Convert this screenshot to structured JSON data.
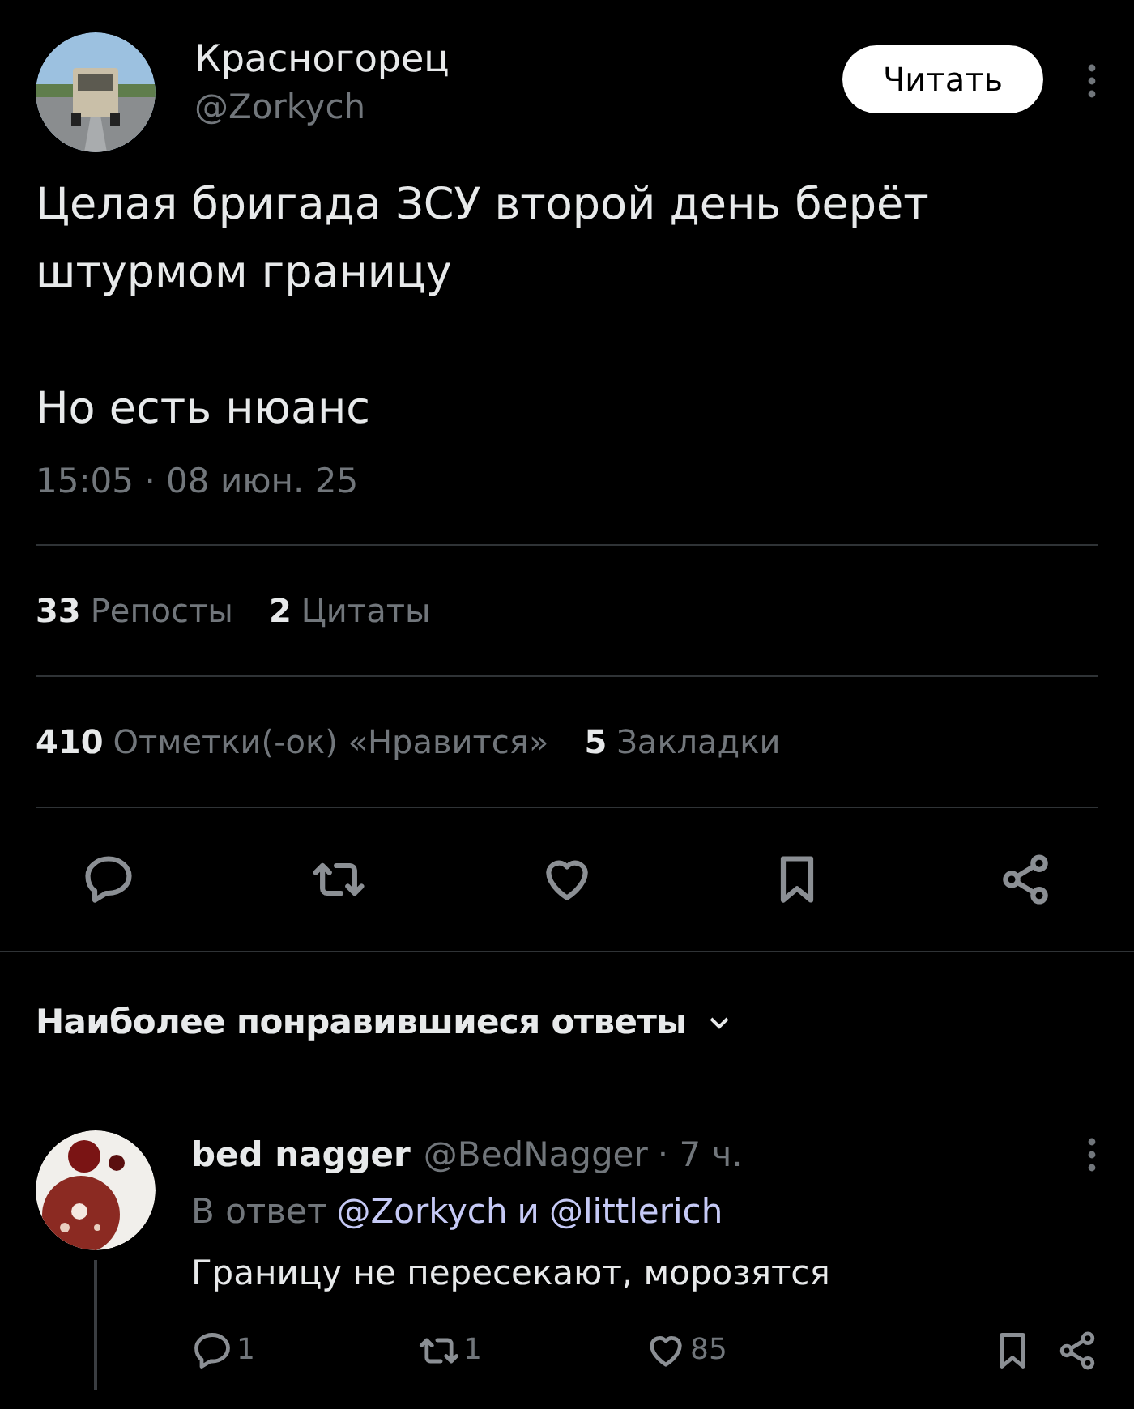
{
  "tweet": {
    "author": "Красногорец",
    "handle": "@Zorkych",
    "follow_button": "Читать",
    "text_lines": [
      "Целая бригада ЗСУ второй день берёт штурмом границу",
      "Но есть нюанс"
    ],
    "timestamp": "15:05 · 08 июн. 25",
    "stats_rows": [
      [
        {
          "count": "33",
          "label": "Репосты"
        },
        {
          "count": "2",
          "label": "Цитаты"
        }
      ],
      [
        {
          "count": "410",
          "label": "Отметки(-ок) «Нравится»"
        },
        {
          "count": "5",
          "label": "Закладки"
        }
      ]
    ],
    "actions": [
      {
        "kind": "reply"
      },
      {
        "kind": "repost"
      },
      {
        "kind": "like"
      },
      {
        "kind": "bookmark"
      },
      {
        "kind": "share"
      }
    ]
  },
  "replies_header": {
    "title": "Наиболее понравившиеся ответы"
  },
  "replies": [
    {
      "author": "bed nagger",
      "handle": "@BedNagger",
      "time": "· 7 ч.",
      "reply_to_prefix": "В ответ",
      "mentions": [
        "@Zorkych",
        "@littlerich"
      ],
      "mention_joiner": "и",
      "text": "Границу не пересекают, морозятся",
      "actions": [
        {
          "kind": "reply",
          "count": "1"
        },
        {
          "kind": "repost",
          "count": "1"
        },
        {
          "kind": "like",
          "count": "85"
        },
        {
          "kind": "bookmark"
        },
        {
          "kind": "share"
        }
      ]
    }
  ]
}
